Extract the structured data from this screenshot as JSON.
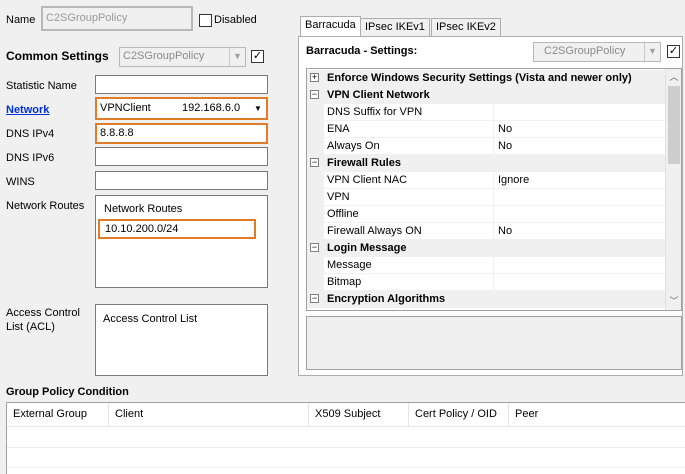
{
  "name": {
    "label": "Name",
    "value": "C2SGroupPolicy",
    "disabled_label": "Disabled"
  },
  "common_settings": {
    "title": "Common Settings",
    "combo_value": "C2SGroupPolicy",
    "checked_mark": "✓"
  },
  "fields": {
    "statistic_name": {
      "label": "Statistic Name",
      "value": ""
    },
    "network": {
      "label": "Network",
      "value": "VPNClient",
      "ip": "192.168.6.0"
    },
    "dns_ipv4": {
      "label": "DNS IPv4",
      "value": "8.8.8.8"
    },
    "dns_ipv6": {
      "label": "DNS IPv6",
      "value": ""
    },
    "wins": {
      "label": "WINS",
      "value": ""
    },
    "network_routes": {
      "label": "Network Routes",
      "header": "Network Routes",
      "value": "10.10.200.0/24"
    },
    "acl": {
      "label_line1": "Access Control",
      "label_line2": "List (ACL)",
      "header": "Access Control List"
    }
  },
  "tabs": [
    {
      "label": "Barracuda",
      "active": true
    },
    {
      "label": "IPsec IKEv1",
      "active": false
    },
    {
      "label": "IPsec IKEv2",
      "active": false
    }
  ],
  "settings": {
    "title": "Barracuda - Settings:",
    "combo_value": "C2SGroupPolicy",
    "checked_mark": "✓"
  },
  "property_grid": {
    "rows": [
      {
        "type": "category",
        "expander": "+",
        "name": "Enforce Windows Security Settings (Vista and newer only)"
      },
      {
        "type": "category",
        "expander": "−",
        "name": "VPN Client Network"
      },
      {
        "type": "prop",
        "name": "DNS Suffix for VPN",
        "value": ""
      },
      {
        "type": "prop",
        "name": "ENA",
        "value": "No"
      },
      {
        "type": "prop",
        "name": "Always On",
        "value": "No"
      },
      {
        "type": "category",
        "expander": "−",
        "name": "Firewall Rules"
      },
      {
        "type": "prop",
        "name": "VPN Client NAC",
        "value": "Ignore"
      },
      {
        "type": "prop",
        "name": "VPN",
        "value": ""
      },
      {
        "type": "prop",
        "name": "Offline",
        "value": ""
      },
      {
        "type": "prop",
        "name": "Firewall Always ON",
        "value": "No"
      },
      {
        "type": "category",
        "expander": "−",
        "name": "Login Message"
      },
      {
        "type": "prop",
        "name": "Message",
        "value": ""
      },
      {
        "type": "prop",
        "name": "Bitmap",
        "value": ""
      },
      {
        "type": "category",
        "expander": "−",
        "name": "Encryption Algorithms"
      }
    ]
  },
  "group_policy": {
    "title": "Group Policy Condition",
    "columns": [
      "External Group",
      "Client",
      "X509 Subject",
      "Cert Policy / OID",
      "Peer"
    ]
  },
  "colors": {
    "highlight": "#e07b28",
    "link": "#0033cc"
  }
}
